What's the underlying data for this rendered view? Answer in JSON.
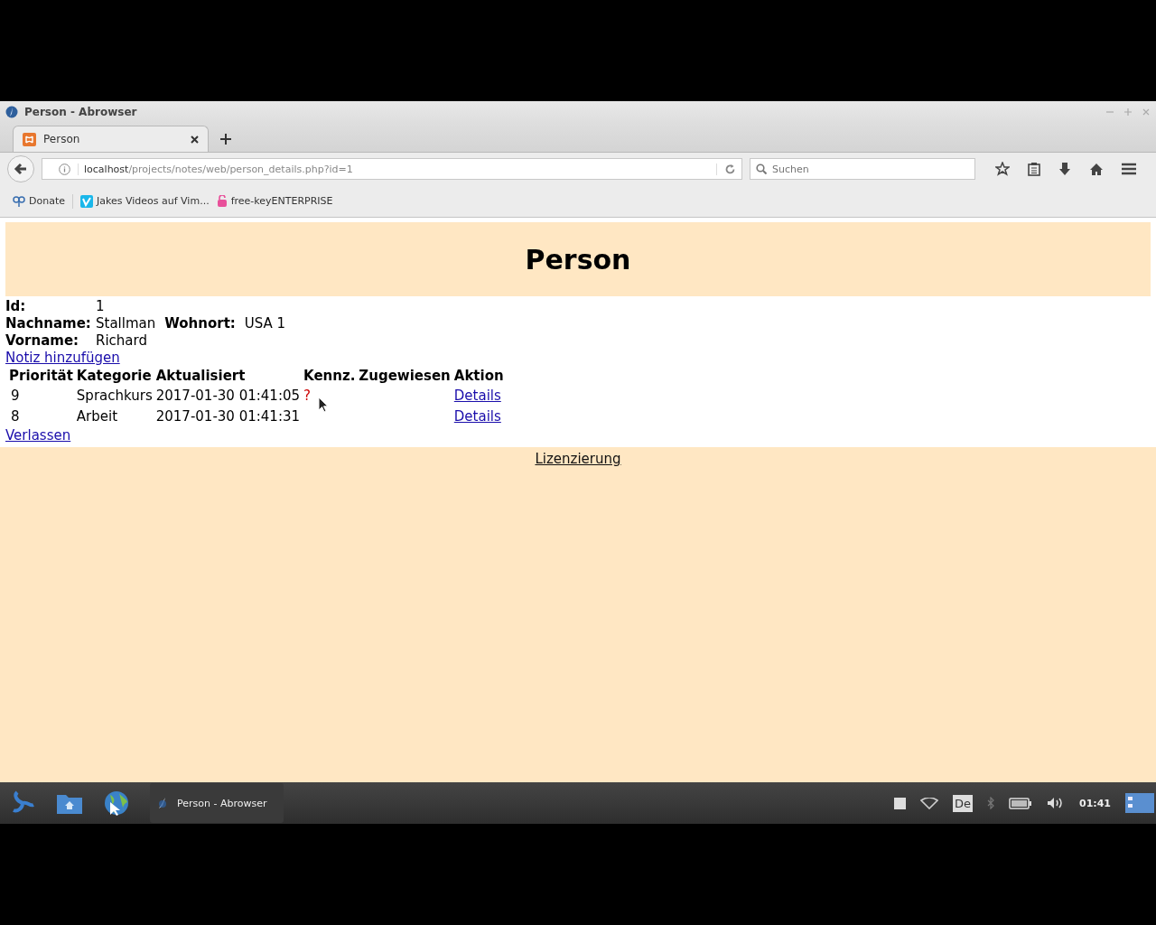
{
  "window": {
    "title": "Person - Abrowser"
  },
  "tabs": [
    {
      "label": "Person",
      "selected": true
    }
  ],
  "address_bar": {
    "host": "localhost",
    "path": "/projects/notes/web/person_details.php?id=1"
  },
  "search": {
    "placeholder": "Suchen"
  },
  "bookmarks": [
    "Donate",
    "Jakes Videos auf Vim...",
    "free-keyENTERPRISE"
  ],
  "page": {
    "heading": "Person",
    "fields": [
      [
        {
          "label": "Id:",
          "value": "1"
        }
      ],
      [
        {
          "label": "Nachname:",
          "value": "Stallman"
        },
        {
          "label": "Wohnort:",
          "value": "USA 1"
        }
      ],
      [
        {
          "label": "Vorname:",
          "value": "Richard"
        }
      ]
    ],
    "add_link": "Notiz hinzufügen",
    "table": {
      "columns": [
        "Priorität",
        "Kategorie",
        "Aktualisiert",
        "Kennz.",
        "Zugewiesen",
        "Aktion"
      ],
      "rows": [
        {
          "priority": "9",
          "category": "Sprachkurs",
          "updated": "2017-01-30 01:41:05",
          "flag": "?",
          "action": "Details"
        },
        {
          "priority": "8",
          "category": "Arbeit",
          "updated": "2017-01-30 01:41:31",
          "action": "Details"
        }
      ]
    },
    "exit_link": "Verlassen",
    "footer_link": "Lizenzierung"
  },
  "taskbar": {
    "windows": [
      {
        "label": "Person - Abrowser",
        "selected": true
      }
    ],
    "keyboard_layout": "De",
    "clock": "01:41"
  }
}
